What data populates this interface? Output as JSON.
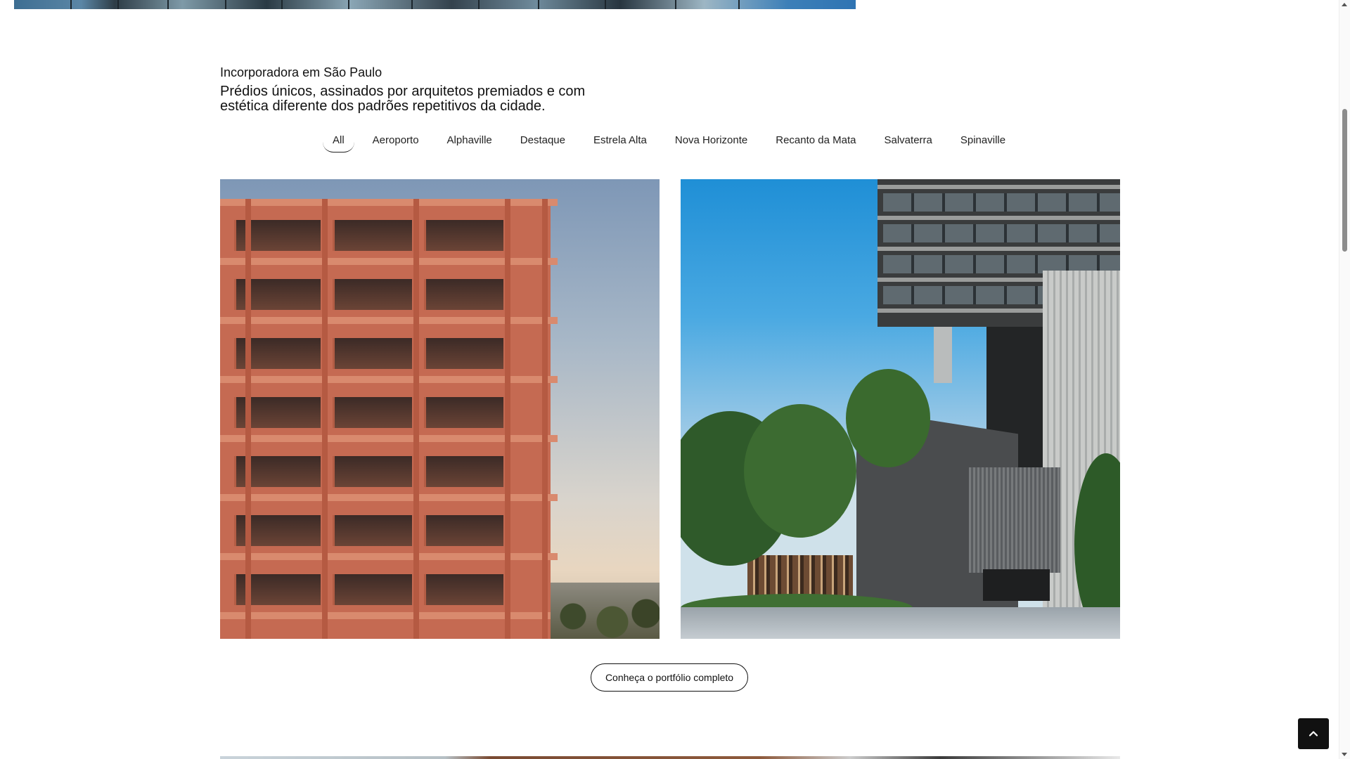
{
  "intro": {
    "eyebrow": "Incorporadora em São Paulo",
    "headline": "Prédios únicos, assinados por arquitetos premiados e com estética diferente dos padrões repetitivos da cidade."
  },
  "filters": {
    "active": "All",
    "items": [
      "All",
      "Aeroporto",
      "Alphaville",
      "Destaque",
      "Estrela Alta",
      "Nova Horizonte",
      "Recanto da Mata",
      "Salvaterra",
      "Spinaville"
    ]
  },
  "cards": [
    {
      "image": "terracotta-residential-tower-render"
    },
    {
      "image": "modern-concrete-tower-with-garden-render"
    }
  ],
  "cta": {
    "portfolio_label": "Conheça o portfólio completo"
  },
  "icons": {
    "scroll_top": "chevron-up-icon"
  },
  "colors": {
    "text": "#111111",
    "button_dark": "#111111",
    "background": "#ffffff"
  }
}
